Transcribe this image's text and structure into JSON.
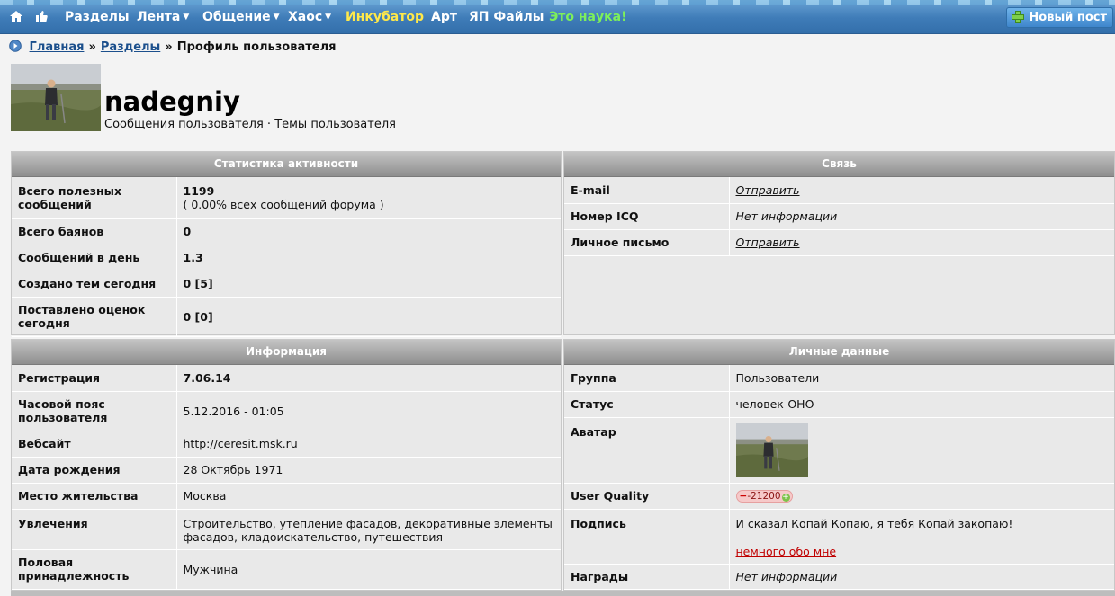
{
  "nav": {
    "items": [
      {
        "label": "Разделы",
        "caret": ""
      },
      {
        "label": "Лента",
        "caret": "▼"
      },
      {
        "label": "Общение",
        "caret": "▼"
      },
      {
        "label": "Хаос",
        "caret": "▼"
      },
      {
        "label": "Инкубатор",
        "caret": ""
      },
      {
        "label": "Арт",
        "caret": ""
      },
      {
        "label": "ЯП Файлы",
        "caret": ""
      },
      {
        "label": "Это наука!",
        "caret": ""
      }
    ],
    "new_post": "Новый пост"
  },
  "breadcrumb": {
    "home": "Главная",
    "sep1": "»",
    "sections": "Разделы",
    "sep2": "»",
    "current": "Профиль пользователя"
  },
  "profile": {
    "username": "nadegniy",
    "posts_link": "Сообщения пользователя",
    "dot": "·",
    "topics_link": "Темы пользователя"
  },
  "stats": {
    "title": "Статистика активности",
    "rows": [
      {
        "label": "Всего полезных сообщений",
        "value": "1199",
        "sub": "( 0.00% всех сообщений форума )"
      },
      {
        "label": "Всего баянов",
        "value": "0"
      },
      {
        "label": "Сообщений в день",
        "value": "1.3"
      },
      {
        "label": "Создано тем сегодня",
        "value": "0 [5]"
      },
      {
        "label": "Поставлено оценок сегодня",
        "value": "0 [0]"
      }
    ]
  },
  "contact": {
    "title": "Связь",
    "rows": [
      {
        "label": "E-mail",
        "value": "Отправить"
      },
      {
        "label": "Номер ICQ",
        "value": "Нет информации"
      },
      {
        "label": "Личное письмо",
        "value": "Отправить"
      }
    ]
  },
  "info": {
    "title": "Информация",
    "rows": [
      {
        "label": "Регистрация",
        "value": "7.06.14"
      },
      {
        "label": "Часовой пояс пользователя",
        "value": "5.12.2016 - 01:05"
      },
      {
        "label": "Вебсайт",
        "value": "http://ceresit.msk.ru"
      },
      {
        "label": "Дата рождения",
        "value": "28 Октябрь 1971"
      },
      {
        "label": "Место жительства",
        "value": "Москва"
      },
      {
        "label": "Увлечения",
        "value": "Строительство, утепление фасадов, декоративные элементы фасадов, кладоискательство, путешествия"
      },
      {
        "label": "Половая принадлежность",
        "value": "Мужчина"
      }
    ]
  },
  "personal": {
    "title": "Личные данные",
    "rows": [
      {
        "label": "Группа",
        "value": "Пользователи"
      },
      {
        "label": "Статус",
        "value": "человек-ОНО"
      },
      {
        "label": "Аватар",
        "value": ""
      },
      {
        "label": "User Quality",
        "value": "-21200",
        "minus": "−",
        "plus": "+"
      },
      {
        "label": "Подпись",
        "value": "И сказал Копай Копаю, я тебя Копай закопаю!",
        "link": "немного обо мне"
      },
      {
        "label": "Награды",
        "value": "Нет информации"
      }
    ]
  },
  "colors": {
    "nav_yellow": "#ffe94a",
    "nav_green": "#7df05a",
    "sig_link": "#c00000"
  }
}
